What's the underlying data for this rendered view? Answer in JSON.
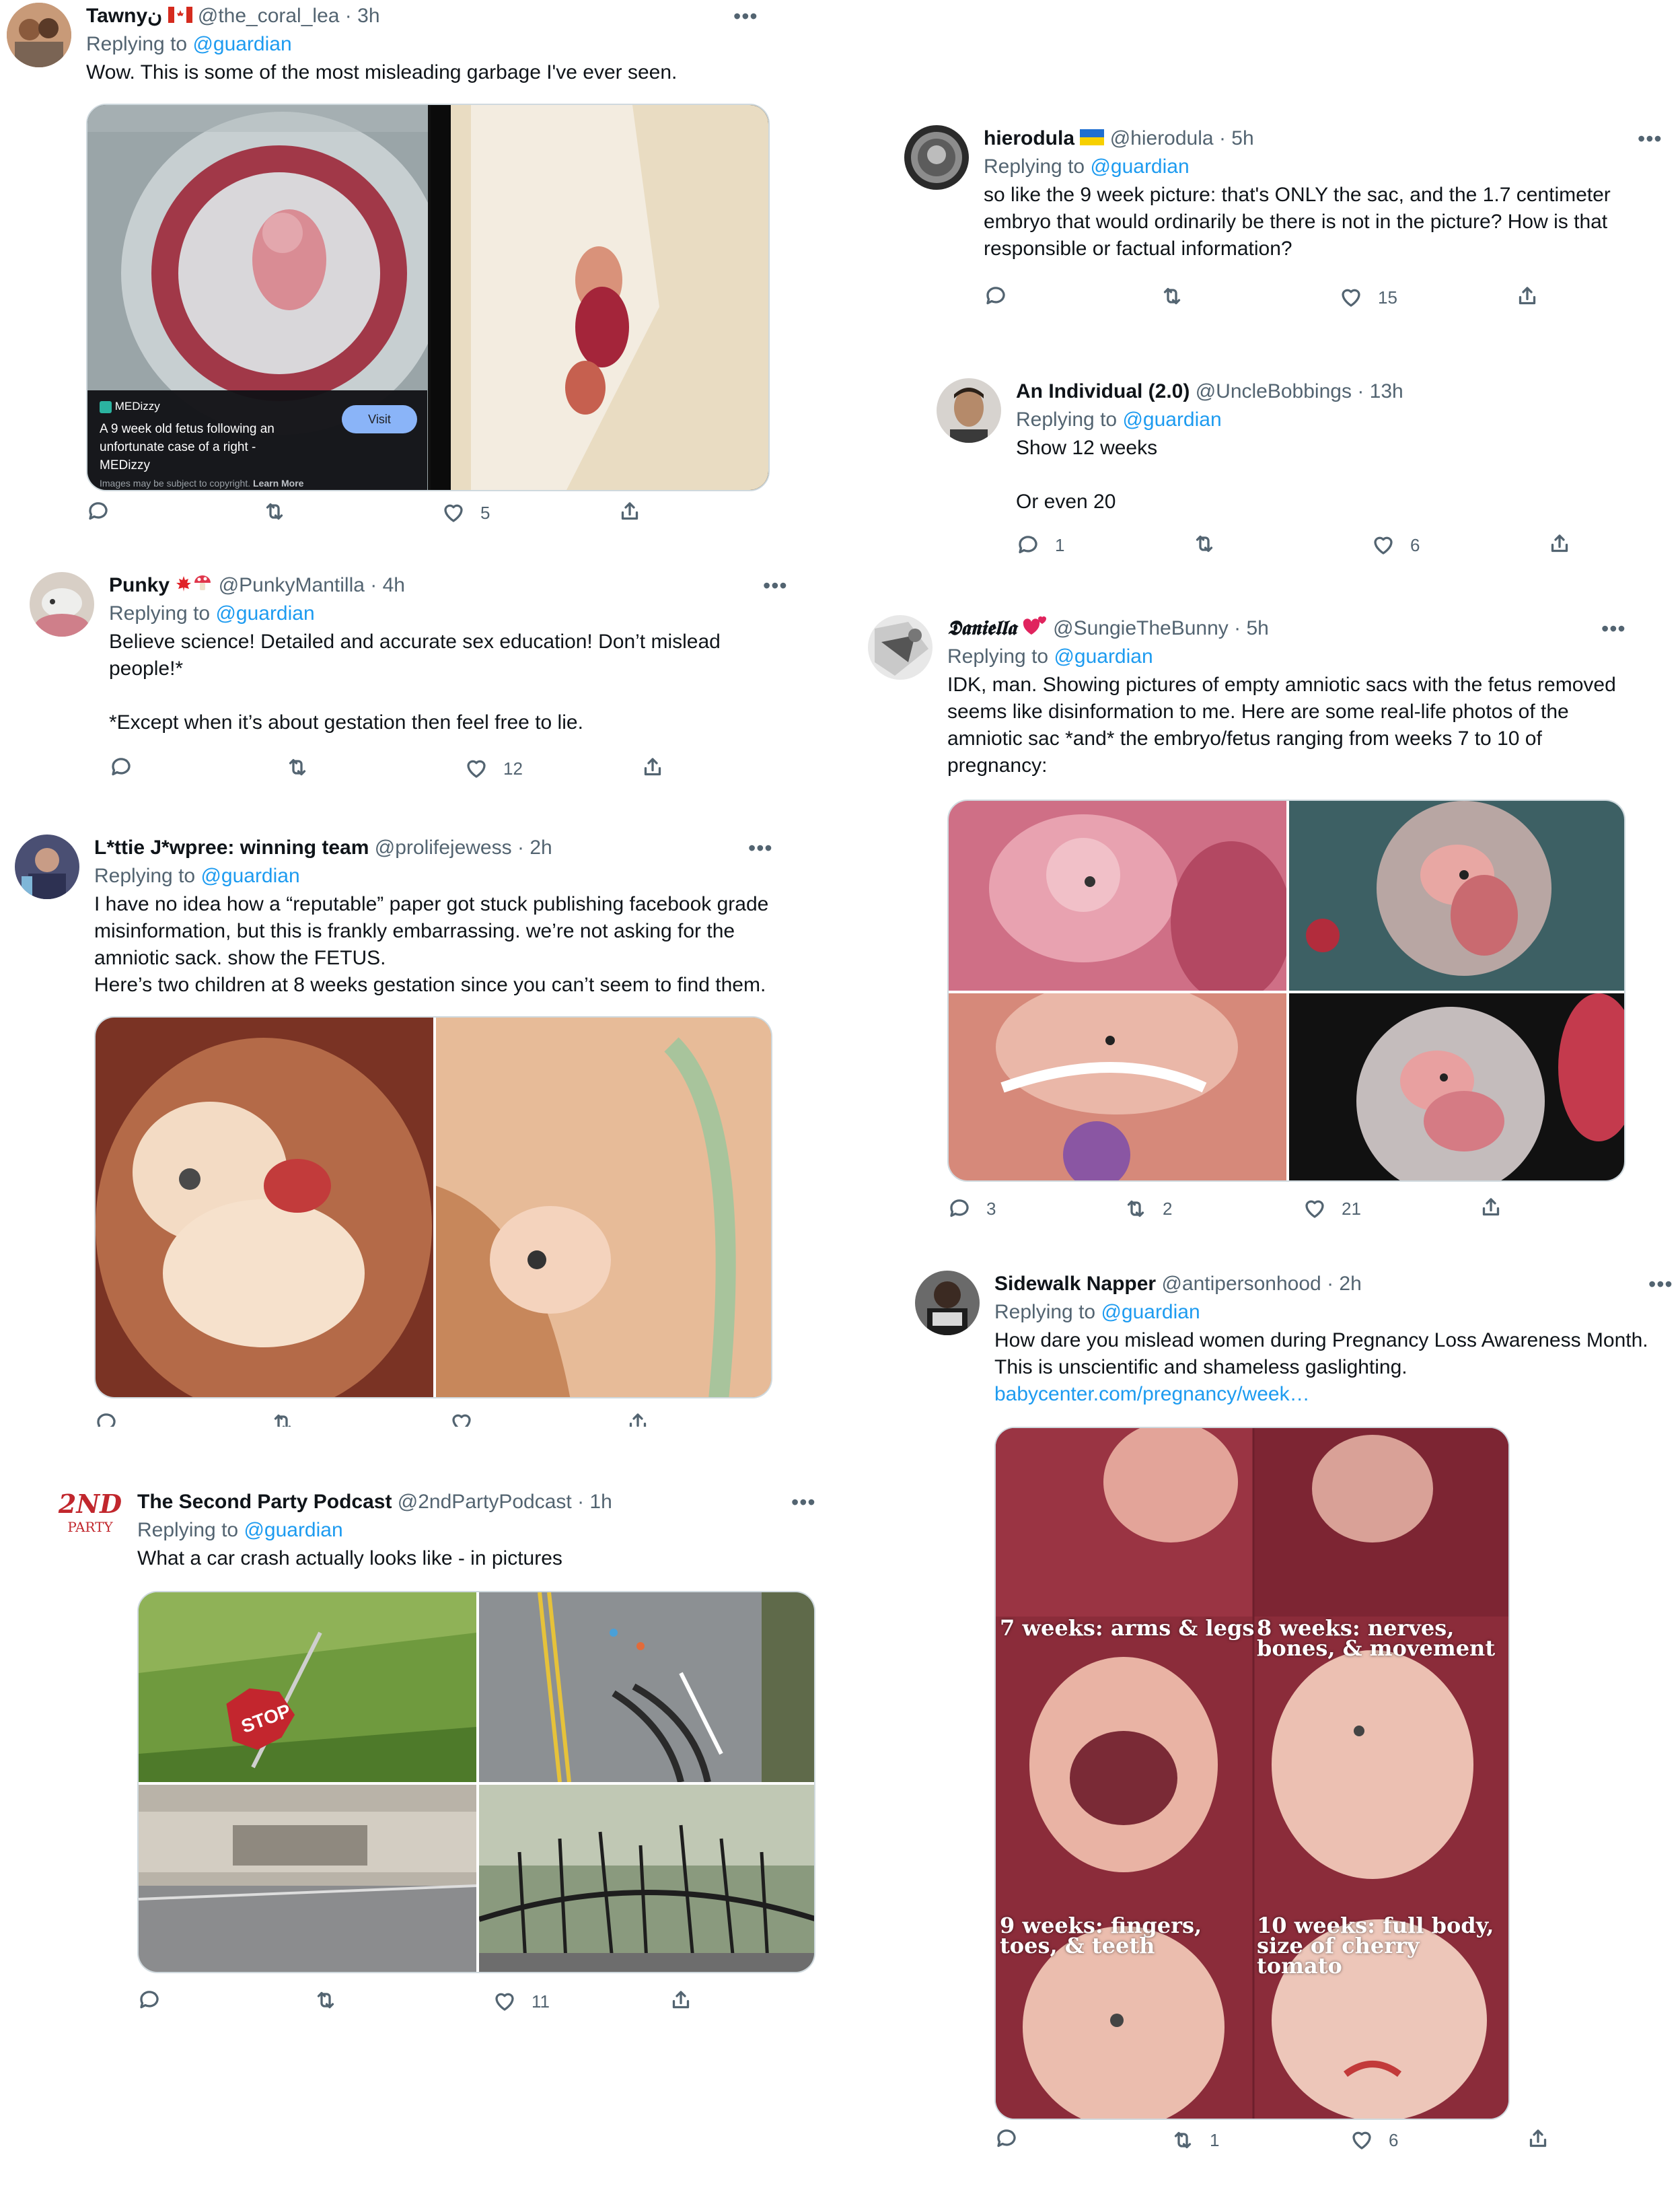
{
  "tweets": {
    "t1": {
      "name": "Tawny",
      "name_suffix": "ن",
      "handle": "@the_coral_lea",
      "time": "3h",
      "reply_prefix": "Replying to ",
      "reply_to": "@guardian",
      "text": "Wow. This is some of the most misleading garbage I've ever seen.",
      "card": {
        "source": "MEDizzy",
        "title": "A 9 week old fetus following an unfortunate case of a right - MEDizzy",
        "button": "Visit",
        "note": "Images may be subject to copyright.",
        "learn_more": "Learn More"
      },
      "likes": "5"
    },
    "t2": {
      "name": "hierodula",
      "handle": "@hierodula",
      "time": "5h",
      "reply_prefix": "Replying to ",
      "reply_to": "@guardian",
      "text": "so like the 9 week picture: that's ONLY the sac, and the 1.7 centimeter embryo that would ordinarily be there is not in the picture? How is that responsible or factual information?",
      "likes": "15"
    },
    "t3": {
      "name": "An Individual (2.0)",
      "handle": "@UncleBobbings",
      "time": "13h",
      "reply_prefix": "Replying to ",
      "reply_to": "@guardian",
      "text": "Show 12 weeks\n\nOr even 20",
      "replies": "1",
      "likes": "6"
    },
    "t4": {
      "name": "Punky",
      "handle": "@PunkyMantilla",
      "time": "4h",
      "reply_prefix": "Replying to ",
      "reply_to": "@guardian",
      "text": "Believe science! Detailed and accurate sex education! Don’t mislead people!*\n\n*Except when it’s about gestation then feel free to lie.",
      "likes": "12"
    },
    "t5": {
      "name": "𝕯𝖆𝖓𝖎𝖊𝖑𝖑𝖆",
      "handle": "@SungieTheBunny",
      "time": "5h",
      "reply_prefix": "Replying to ",
      "reply_to": "@guardian",
      "text": "IDK, man. Showing pictures of empty amniotic sacs with the fetus removed seems like disinformation to me. Here are some real-life photos of the amniotic sac *and* the embryo/fetus ranging from weeks 7 to 10 of pregnancy:",
      "replies": "3",
      "retweets": "2",
      "likes": "21"
    },
    "t6": {
      "name": "L*ttie J*wpree: winning team",
      "handle": "@prolifejewess",
      "time": "2h",
      "reply_prefix": "Replying to ",
      "reply_to": "@guardian",
      "text": "I have no idea how a “reputable” paper got stuck publishing facebook grade misinformation, but this is frankly embarrassing. we’re not asking for the amniotic sack. show the FETUS.\nHere’s two children at 8 weeks gestation since you can’t seem to find them."
    },
    "t7": {
      "name": "Sidewalk Napper",
      "handle": "@antipersonhood",
      "time": "2h",
      "reply_prefix": "Replying to ",
      "reply_to": "@guardian",
      "text": "How dare you mislead women during Pregnancy Loss Awareness Month. This is unscientific and shameless gaslighting.",
      "link": "babycenter.com/pregnancy/week…",
      "captions": [
        "7 weeks: arms & legs",
        "8 weeks: nerves,\nbones, & movement",
        "9 weeks: fingers,\ntoes, & teeth",
        "10 weeks: full body,\nsize of cherry tomato"
      ],
      "retweets": "1",
      "likes": "6"
    },
    "t8": {
      "name": "The Second Party Podcast",
      "handle": "@2ndPartyPodcast",
      "time": "1h",
      "reply_prefix": "Replying to ",
      "reply_to": "@guardian",
      "text": "What a car crash actually looks like - in pictures",
      "avatar_text": "2ND",
      "avatar_sub": "PARTY",
      "sign": "STOP",
      "likes": "11"
    }
  },
  "separator": "·",
  "more": "•••",
  "colors": {
    "link": "#1d9bf0",
    "muted": "#536471",
    "text": "#0f1419"
  }
}
